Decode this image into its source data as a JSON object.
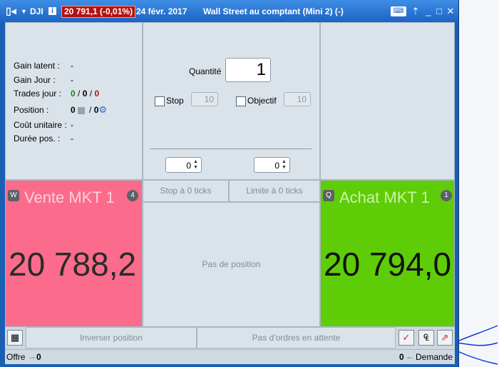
{
  "titlebar": {
    "symbol": "DJI",
    "info_icon": "i",
    "price_change": "20 791,1 (-0,01%)",
    "date": "24 févr. 2017",
    "instrument": "Wall Street au comptant (Mini 2) (-)",
    "icons": [
      "window-icon",
      "keyboard-icon",
      "pin-icon",
      "minimize-icon",
      "maximize-icon",
      "close-icon"
    ]
  },
  "info": {
    "gain_latent_label": "Gain latent :",
    "gain_latent_value": "-",
    "gain_jour_label": "Gain Jour :",
    "gain_jour_value": "-",
    "trades_jour_label": "Trades jour :",
    "trades_green": "0",
    "trades_sep1": "/",
    "trades_black": "0",
    "trades_sep2": "/",
    "trades_red": "0",
    "position_label": "Position :",
    "position_value": "0",
    "position_sep": "/",
    "position_value2": "0",
    "cout_label": "Coût unitaire :",
    "cout_value": "-",
    "duree_label": "Durée pos. :",
    "duree_value": "-"
  },
  "order": {
    "quantity_label": "Quantité",
    "quantity_value": "1",
    "stop_label": "Stop",
    "stop_value": "10",
    "objectif_label": "Objectif",
    "objectif_value": "10",
    "spin_left": "0",
    "spin_right": "0"
  },
  "sell": {
    "badge": "W",
    "title": "Vente MKT 1",
    "count": "4",
    "price": "20 788,2",
    "color": "#fb6b8c"
  },
  "buy": {
    "badge": "Q",
    "title": "Achat MKT 1",
    "count": "1",
    "price": "20 794,0",
    "color": "#5fcc08"
  },
  "middle": {
    "stop_ticks": "Stop à 0 ticks",
    "limit_ticks": "Limite à 0 ticks",
    "no_position": "Pas de position"
  },
  "bottom": {
    "reverse": "Inverser position",
    "no_orders": "Pas d'ordres en attente"
  },
  "status": {
    "offer_label": "Offre",
    "offer_value": "0",
    "demand_value": "0",
    "demand_label": "Demande"
  }
}
